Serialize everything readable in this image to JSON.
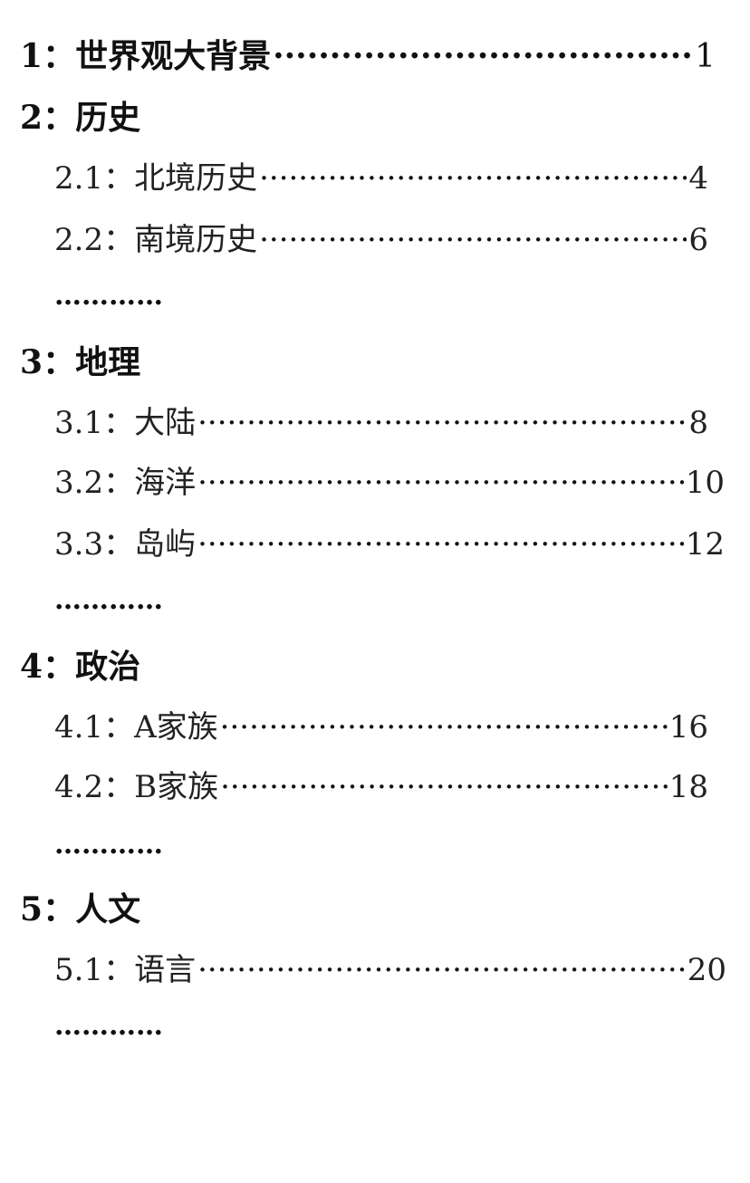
{
  "toc": {
    "sections": [
      {
        "num": "1",
        "title": "世界观大背景",
        "page": "1"
      },
      {
        "num": "2",
        "title": "历史",
        "subs": [
          {
            "num": "2.1",
            "title": "北境历史",
            "page": "4"
          },
          {
            "num": "2.2",
            "title": "南境历史",
            "page": "6"
          }
        ],
        "more": "…………"
      },
      {
        "num": "3",
        "title": "地理",
        "subs": [
          {
            "num": "3.1",
            "title": "大陆",
            "page": "8"
          },
          {
            "num": "3.2",
            "title": "海洋",
            "page": "10"
          },
          {
            "num": "3.3",
            "title": "岛屿",
            "page": "12"
          }
        ],
        "more": "…………"
      },
      {
        "num": "4",
        "title": "政治",
        "subs": [
          {
            "num": "4.1",
            "title": "A家族",
            "page": "16"
          },
          {
            "num": "4.2",
            "title": "B家族",
            "page": "18"
          }
        ],
        "more": "…………"
      },
      {
        "num": "5",
        "title": "人文",
        "subs": [
          {
            "num": "5.1",
            "title": "语言",
            "page": "20"
          }
        ],
        "more": "…………"
      }
    ],
    "separator": "：",
    "leader": "····················································································"
  }
}
